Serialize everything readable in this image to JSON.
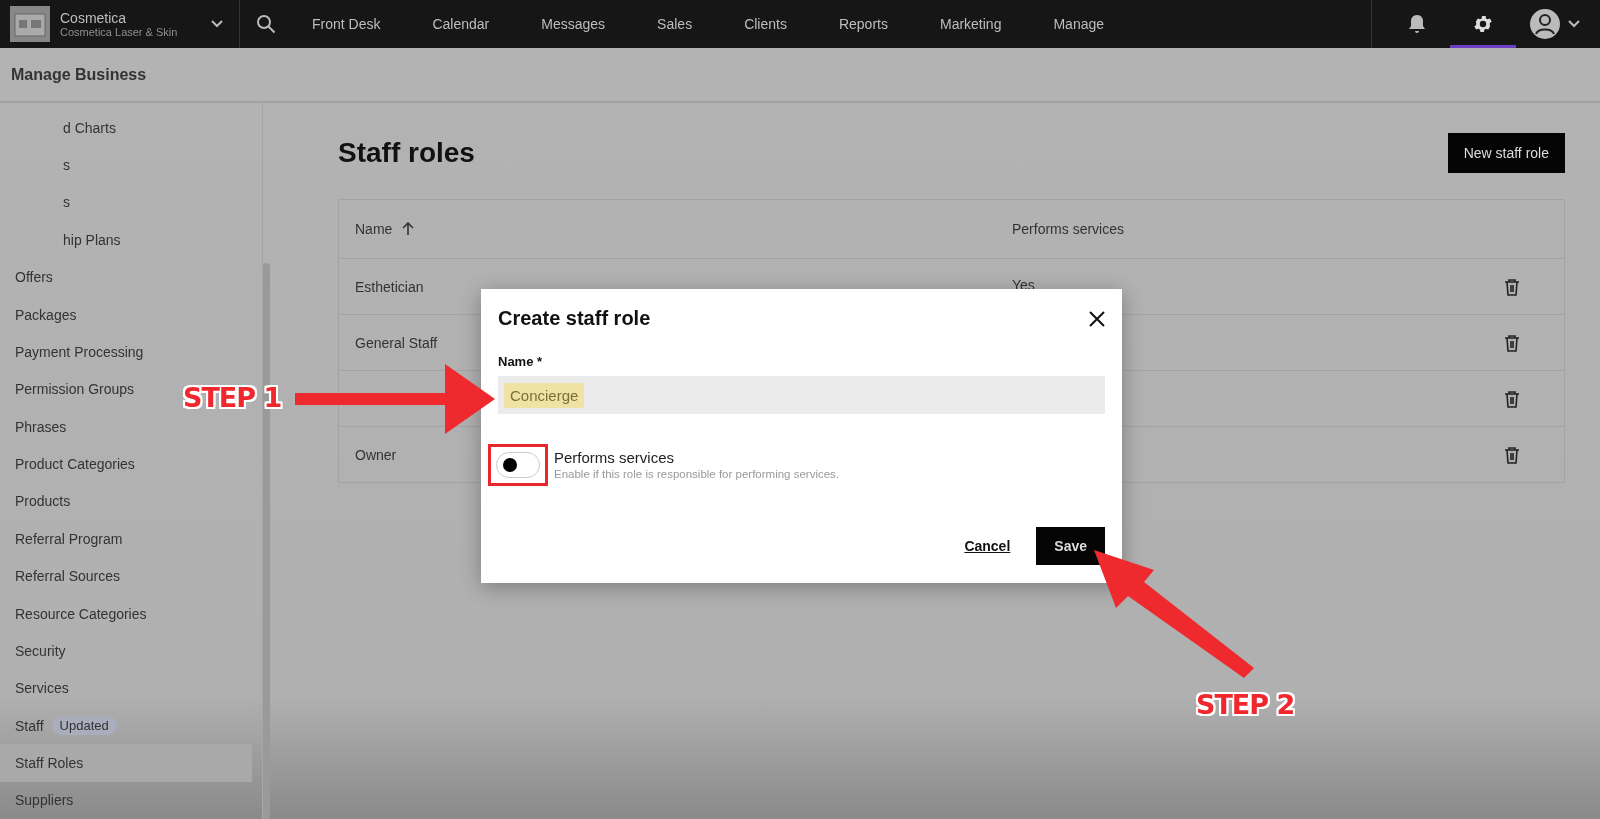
{
  "top_nav": {
    "business_name": "Cosmetica",
    "location": "Cosmetica Laser & Skin",
    "items": [
      {
        "label": "Front Desk",
        "selected": false
      },
      {
        "label": "Calendar",
        "selected": false
      },
      {
        "label": "Messages",
        "selected": false
      },
      {
        "label": "Sales",
        "selected": false
      },
      {
        "label": "Clients",
        "selected": false
      },
      {
        "label": "Reports",
        "selected": false
      },
      {
        "label": "Marketing",
        "selected": false
      },
      {
        "label": "Manage",
        "selected": false
      }
    ],
    "settings_selected": true
  },
  "page_header": {
    "title": "Manage Business"
  },
  "sidebar": {
    "items": [
      {
        "label": "d Charts",
        "selected": false,
        "cut": true
      },
      {
        "label": "s",
        "selected": false,
        "cut": true
      },
      {
        "label": "s",
        "selected": false,
        "cut": true
      },
      {
        "label": "hip Plans",
        "selected": false,
        "cut": true
      },
      {
        "label": "Offers",
        "selected": false
      },
      {
        "label": "Packages",
        "selected": false
      },
      {
        "label": "Payment Processing",
        "selected": false
      },
      {
        "label": "Permission Groups",
        "selected": false
      },
      {
        "label": "Phrases",
        "selected": false
      },
      {
        "label": "Product Categories",
        "selected": false
      },
      {
        "label": "Products",
        "selected": false
      },
      {
        "label": "Referral Program",
        "selected": false
      },
      {
        "label": "Referral Sources",
        "selected": false
      },
      {
        "label": "Resource Categories",
        "selected": false
      },
      {
        "label": "Security",
        "selected": false
      },
      {
        "label": "Services",
        "selected": false
      },
      {
        "label": "Staff",
        "selected": false,
        "badge": "Updated"
      },
      {
        "label": "Staff Roles",
        "selected": true
      },
      {
        "label": "Suppliers",
        "selected": false
      }
    ]
  },
  "main": {
    "title": "Staff roles",
    "new_button": "New staff role",
    "table": {
      "columns": [
        "Name",
        "Performs services"
      ],
      "rows": [
        {
          "name": "Esthetician",
          "performs_services": "Yes"
        },
        {
          "name": "General Staff"
        },
        {},
        {
          "name": "Owner"
        }
      ]
    }
  },
  "modal": {
    "title": "Create staff role",
    "name_label": "Name *",
    "name_value": "Concierge",
    "name_highlighted": true,
    "toggle_label": "Performs services",
    "toggle_help": "Enable if this role is responsible for performing services.",
    "toggle_on": false,
    "toggle_highlighted": true,
    "cancel": "Cancel",
    "save": "Save"
  },
  "annotations": [
    {
      "text": "STEP 1"
    },
    {
      "text": "STEP 2"
    }
  ]
}
